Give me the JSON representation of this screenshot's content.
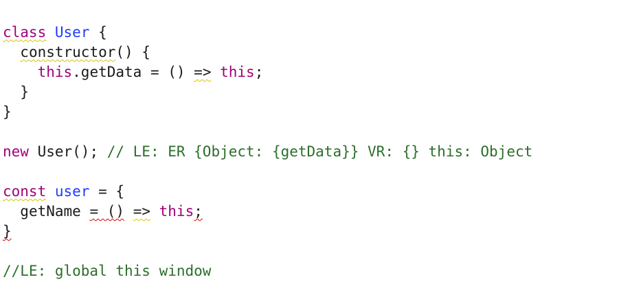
{
  "code": {
    "line1": {
      "kw": "class",
      "sp": " ",
      "cls": "User",
      "rest": " {"
    },
    "line2": {
      "indent": "  ",
      "fn": "constructor",
      "rest": "() {"
    },
    "line3": {
      "indent": "    ",
      "kw": "this",
      "mid": ".getData = () ",
      "arrow": "=>",
      "sp": " ",
      "kw2": "this",
      "end": ";"
    },
    "line4": {
      "text": "  }"
    },
    "line5": {
      "text": "}"
    },
    "line6": {
      "text": ""
    },
    "line7": {
      "kw": "new",
      "mid": " User(); ",
      "comment": "// LE: ER {Object: {getData}} VR: {} this: Object"
    },
    "line8": {
      "text": ""
    },
    "line9": {
      "kw": "const",
      "sp": " ",
      "cls": "user",
      "rest": " = {"
    },
    "line10": {
      "indent": "  ",
      "name": "getName ",
      "err": "= ()",
      "sp": " ",
      "arrow": "=>",
      "sp2": " ",
      "kw": "this",
      "end": ";"
    },
    "line11": {
      "brace": "}"
    },
    "line12": {
      "text": ""
    },
    "line13": {
      "comment": "//LE: global this window"
    }
  }
}
